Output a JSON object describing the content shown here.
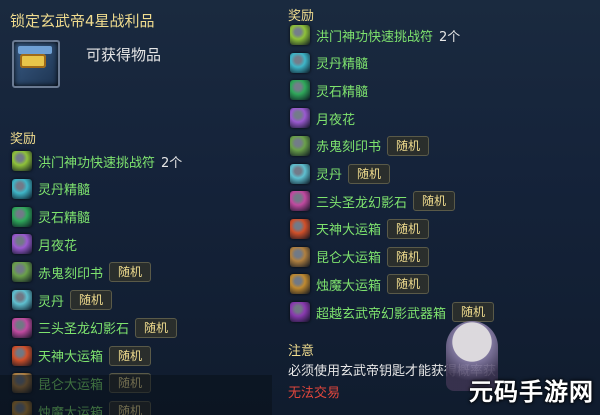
{
  "left": {
    "title": "锁定玄武帝4星战利品",
    "obtain": "可获得物品",
    "reward_header": "奖励",
    "items": [
      {
        "name": "洪门神功快速挑战符",
        "qty": "2个",
        "tag": "",
        "icon": "scroll-icon",
        "color": "#8fc23a"
      },
      {
        "name": "灵丹精髓",
        "qty": "",
        "tag": "",
        "icon": "orb-icon",
        "color": "#3fb6c8"
      },
      {
        "name": "灵石精髓",
        "qty": "",
        "tag": "",
        "icon": "crystal-icon",
        "color": "#2fa85a"
      },
      {
        "name": "月夜花",
        "qty": "",
        "tag": "",
        "icon": "flower-icon",
        "color": "#9a5ad0"
      },
      {
        "name": "赤鬼刻印书",
        "qty": "",
        "tag": "随机",
        "icon": "book-icon",
        "color": "#6aa04a"
      },
      {
        "name": "灵丹",
        "qty": "",
        "tag": "随机",
        "icon": "pill-icon",
        "color": "#5fc0d0"
      },
      {
        "name": "三头圣龙幻影石",
        "qty": "",
        "tag": "随机",
        "icon": "dragon-stone-icon",
        "color": "#c04aa0"
      },
      {
        "name": "天神大运箱",
        "qty": "",
        "tag": "随机",
        "icon": "chest-icon",
        "color": "#d0502a"
      },
      {
        "name": "昆仑大运箱",
        "qty": "",
        "tag": "随机",
        "icon": "chest-icon",
        "color": "#b08040"
      },
      {
        "name": "烛魔大运箱",
        "qty": "",
        "tag": "随机",
        "icon": "chest-icon",
        "color": "#c08a30"
      }
    ]
  },
  "right": {
    "reward_header": "奖励",
    "items": [
      {
        "name": "洪门神功快速挑战符",
        "qty": "2个",
        "tag": "",
        "icon": "scroll-icon",
        "color": "#8fc23a"
      },
      {
        "name": "灵丹精髓",
        "qty": "",
        "tag": "",
        "icon": "orb-icon",
        "color": "#3fb6c8"
      },
      {
        "name": "灵石精髓",
        "qty": "",
        "tag": "",
        "icon": "crystal-icon",
        "color": "#2fa85a"
      },
      {
        "name": "月夜花",
        "qty": "",
        "tag": "",
        "icon": "flower-icon",
        "color": "#9a5ad0"
      },
      {
        "name": "赤鬼刻印书",
        "qty": "",
        "tag": "随机",
        "icon": "book-icon",
        "color": "#6aa04a"
      },
      {
        "name": "灵丹",
        "qty": "",
        "tag": "随机",
        "icon": "pill-icon",
        "color": "#5fc0d0"
      },
      {
        "name": "三头圣龙幻影石",
        "qty": "",
        "tag": "随机",
        "icon": "dragon-stone-icon",
        "color": "#c04aa0"
      },
      {
        "name": "天神大运箱",
        "qty": "",
        "tag": "随机",
        "icon": "chest-icon",
        "color": "#d0502a"
      },
      {
        "name": "昆仑大运箱",
        "qty": "",
        "tag": "随机",
        "icon": "chest-icon",
        "color": "#b08040"
      },
      {
        "name": "烛魔大运箱",
        "qty": "",
        "tag": "随机",
        "icon": "chest-icon",
        "color": "#c08a30"
      },
      {
        "name": "超越玄武帝幻影武器箱",
        "qty": "",
        "tag": "随机",
        "icon": "weapon-chest-icon",
        "color": "#8a3ab0"
      }
    ],
    "note_header": "注意",
    "note": "必须使用玄武帝钥匙才能获得概率获",
    "warning": "无法交易"
  },
  "watermark": {
    "logo": "元码手游网"
  }
}
